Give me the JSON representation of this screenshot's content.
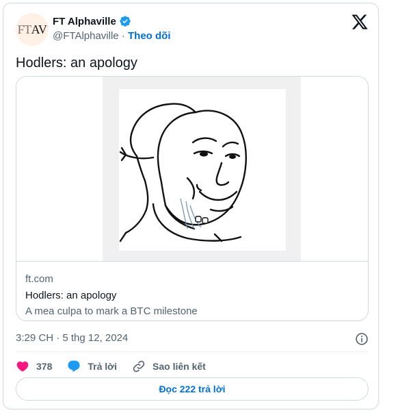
{
  "author": {
    "avatar_text_ft": "FT",
    "avatar_text_av": "AV",
    "name": "FT Alphaville",
    "handle": "@FTAlphaville",
    "separator": " · ",
    "follow_label": "Theo dõi"
  },
  "tweet": {
    "text": "Hodlers: an apology"
  },
  "link_card": {
    "domain": "ft.com",
    "title": "Hodlers: an apology",
    "description": "A mea culpa to mark a BTC milestone"
  },
  "meta": {
    "timestamp": "3:29 CH · 5 thg 12, 2024"
  },
  "actions": {
    "like_count": "378",
    "reply_label": "Trả lời",
    "copy_link_label": "Sao liên kết"
  },
  "read_replies_label": "Đọc 222 trả lời",
  "colors": {
    "accent": "#006fd6",
    "verified": "#1d9bf0",
    "like": "#f91880",
    "border": "#cfd9de"
  }
}
